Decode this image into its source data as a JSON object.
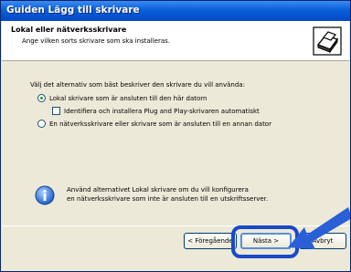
{
  "window": {
    "title": "Guiden Lägg till skrivare"
  },
  "header": {
    "title": "Lokal eller nätverksskrivare",
    "subtitle": "Ange vilken sorts skrivare som ska installeras.",
    "icon": "printer-icon"
  },
  "main": {
    "intro": "Välj det alternativ som bäst beskriver den skrivare du vill använda:",
    "options": [
      {
        "label": "Lokal skrivare som är ansluten till den här datorn",
        "checked": true
      },
      {
        "label": "Identifiera och installera Plug and Play-skrivaren automatiskt",
        "checked": false
      },
      {
        "label": "En nätverksskrivare eller skrivare som är ansluten till en annan dator",
        "checked": false
      }
    ],
    "info_lines": [
      "Använd alternativet Lokal skrivare om du vill konfigurera",
      "en nätverksskrivare som inte är ansluten till en utskriftsserver."
    ]
  },
  "footer": {
    "back_label": "< Föregående",
    "next_label": "Nästa >",
    "cancel_label": "Avbryt"
  },
  "colors": {
    "accent": "#1a48c8",
    "titlebar": "#0a5fd8"
  }
}
